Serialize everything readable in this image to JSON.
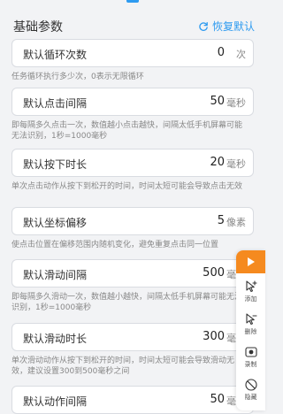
{
  "header": {
    "title": "基础参数",
    "reset_label": "恢复默认"
  },
  "settings": [
    {
      "label": "默认循环次数",
      "value": "0",
      "unit": "次",
      "help": "任务循环执行多少次，0表示无限循环"
    },
    {
      "label": "默认点击间隔",
      "value": "50",
      "unit": "毫秒",
      "help": "即每隔多久点击一次，数值越小点击越快，间隔太低手机屏幕可能无法识别，1秒=1000毫秒"
    },
    {
      "label": "默认按下时长",
      "value": "20",
      "unit": "毫秒",
      "help": "单次点击动作从按下到松开的时间，时间太短可能会导致点击无效"
    },
    {
      "label": "默认坐标偏移",
      "value": "5",
      "unit": "像素",
      "help": "使点击位置在偏移范围内随机变化，避免重复点击同一位置"
    },
    {
      "label": "默认滑动间隔",
      "value": "500",
      "unit": "毫秒",
      "help": "即每隔多久滑动一次，数值越小越快，间隔太低手机屏幕可能无法识别，1秒=1000毫秒"
    },
    {
      "label": "默认滑动时长",
      "value": "300",
      "unit": "毫秒",
      "help": "单次滑动动作从按下到松开的时间，时间太短可能会导致滑动无效，建议设置300到500毫秒之间"
    },
    {
      "label": "默认动作间隔",
      "value": "50",
      "unit": "毫秒",
      "help": ""
    }
  ],
  "toolbar": {
    "play_icon": "play-icon",
    "tools": [
      {
        "icon": "add-point-icon",
        "label": "添加"
      },
      {
        "icon": "remove-point-icon",
        "label": "删除"
      },
      {
        "icon": "record-icon",
        "label": "录制"
      },
      {
        "icon": "hide-icon",
        "label": "隐藏"
      }
    ]
  },
  "colors": {
    "accent": "#2e9bf0",
    "play_button": "#f58a1f",
    "background": "#f2f3f5"
  }
}
